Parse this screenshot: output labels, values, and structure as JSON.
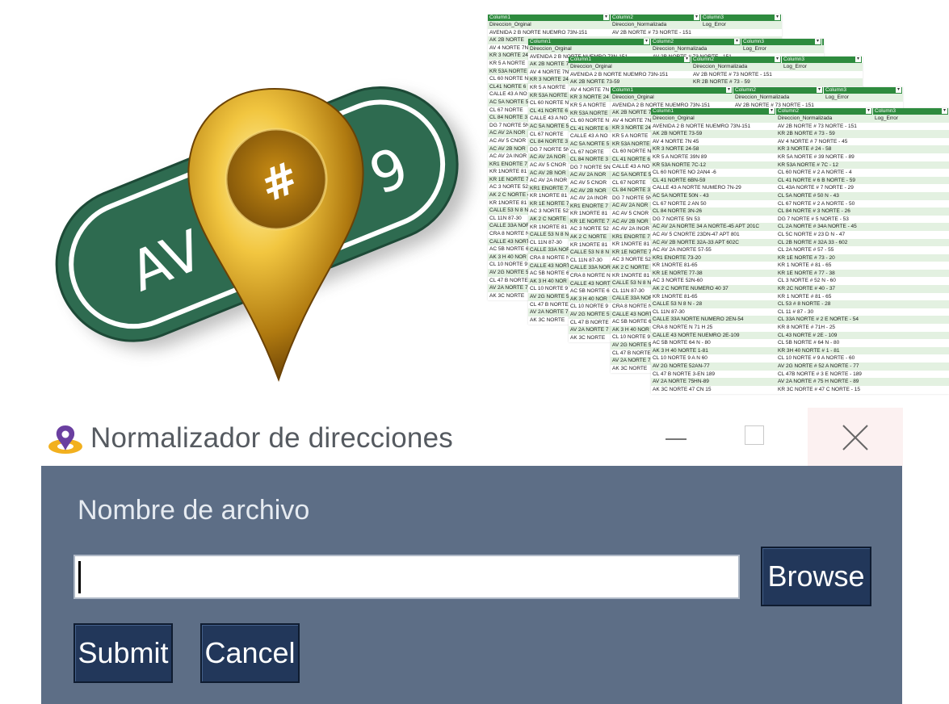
{
  "hero": {
    "sign_text": "AV 5",
    "sign_number": "9",
    "hash_symbol": "#"
  },
  "sheets": [
    {
      "columns": [
        "Column1",
        "Column2",
        "Column3"
      ],
      "rows": [
        [
          "Direccion_Orginal",
          "Direccion_Normalizada",
          "Log_Error"
        ],
        [
          "AVENIDA 2 B NORTE NUEMRO 73N-151",
          "AV 2B NORTE # 73 NORTE - 151",
          ""
        ],
        [
          "AK 2B NORTE",
          "",
          ""
        ],
        [
          "AV 4 NORTE 7N",
          "",
          ""
        ],
        [
          "KR 3 NORTE 24",
          "",
          ""
        ],
        [
          "KR 5 A NORTE",
          "",
          ""
        ],
        [
          "KR 53A NORTE",
          "",
          ""
        ],
        [
          "CL 60 NORTE N",
          "",
          ""
        ],
        [
          "CL41 NORTE 6",
          "",
          ""
        ],
        [
          "CALLE 43 A NO",
          "",
          ""
        ],
        [
          "AC 5A NORTE 5",
          "",
          ""
        ],
        [
          "CL 67 NORTE",
          "",
          ""
        ],
        [
          "CL 84 NORTE 3",
          "",
          ""
        ],
        [
          "DG 7 NORTE 5N",
          "",
          ""
        ],
        [
          "AC AV 2A NOR",
          "",
          ""
        ],
        [
          "AC AV 5 CNOR",
          "",
          ""
        ],
        [
          "AC AV 2B NOR",
          "",
          ""
        ],
        [
          "AC AV 2A INOR",
          "",
          ""
        ],
        [
          "KR1 ENORTE 7",
          "",
          ""
        ],
        [
          "KR 1NORTE 81",
          "",
          ""
        ],
        [
          "KR 1E NORTE 7",
          "",
          ""
        ],
        [
          "AC 3 NORTE 52",
          "",
          ""
        ],
        [
          "AK 2 C NORTE 4",
          "",
          ""
        ],
        [
          "KR 1NORTE 81",
          "",
          ""
        ],
        [
          "CALLE 53 N 8 N",
          "",
          ""
        ],
        [
          "CL 11N 87-30",
          "",
          ""
        ],
        [
          "CALLE 33A NOR",
          "",
          ""
        ],
        [
          "CRA 8 NORTE N",
          "",
          ""
        ],
        [
          "CALLE 43 NORT",
          "",
          ""
        ],
        [
          "AC 5B NORTE 6",
          "",
          ""
        ],
        [
          "AK 3 H 40 NOR",
          "",
          ""
        ],
        [
          "CL 10 NORTE 9",
          "",
          ""
        ],
        [
          "AV 2G NORTE 5",
          "",
          ""
        ],
        [
          "CL 47 B NORTE",
          "",
          ""
        ],
        [
          "AV 2A NORTE 7",
          "",
          ""
        ],
        [
          "AK 3C NORTE",
          "",
          ""
        ]
      ]
    },
    {
      "columns": [
        "Column1",
        "Column2",
        "Column3"
      ],
      "rows": [
        [
          "Direccion_Orginal",
          "Direccion_Normalizada",
          "Log_Error"
        ],
        [
          "AVENIDA 2 B NORTE NUEMRO 73N-151",
          "AV 2B NORTE # 73 NORTE - 151",
          ""
        ],
        [
          "AK 2B NORTE 73",
          "",
          ""
        ],
        [
          "AV 4 NORTE 7N",
          "",
          ""
        ],
        [
          "KR 3 NORTE 24",
          "",
          ""
        ],
        [
          "KR 5 A NORTE",
          "",
          ""
        ],
        [
          "KR 53A NORTE",
          "",
          ""
        ],
        [
          "CL 60 NORTE N",
          "",
          ""
        ],
        [
          "CL 41 NORTE 6",
          "",
          ""
        ],
        [
          "CALLE 43 A NO",
          "",
          ""
        ],
        [
          "AC 5A NORTE 5",
          "",
          ""
        ],
        [
          "CL 67 NORTE",
          "",
          ""
        ],
        [
          "CL 84 NORTE 3",
          "",
          ""
        ],
        [
          "DG 7 NORTE 5N",
          "",
          ""
        ],
        [
          "AC AV 2A NOR",
          "",
          ""
        ],
        [
          "AC AV 5 CNOR",
          "",
          ""
        ],
        [
          "AC AV 2B NOR",
          "",
          ""
        ],
        [
          "AC AV 2A INOR",
          "",
          ""
        ],
        [
          "KR1 ENORTE 7",
          "",
          ""
        ],
        [
          "KR 1NORTE 81",
          "",
          ""
        ],
        [
          "KR 1E NORTE 7",
          "",
          ""
        ],
        [
          "AC 3 NORTE 52",
          "",
          ""
        ],
        [
          "AK 2 C NORTE",
          "",
          ""
        ],
        [
          "KR 1NORTE 81",
          "",
          ""
        ],
        [
          "CALLE 53 N 8 N",
          "",
          ""
        ],
        [
          "CL 11N 87-30",
          "",
          ""
        ],
        [
          "CALLE 33A NOR",
          "",
          ""
        ],
        [
          "CRA 8 NORTE N",
          "",
          ""
        ],
        [
          "CALLE 43 NORT",
          "",
          ""
        ],
        [
          "AC 5B NORTE 6",
          "",
          ""
        ],
        [
          "AK 3 H 40 NOR",
          "",
          ""
        ],
        [
          "CL 10 NORTE 9",
          "",
          ""
        ],
        [
          "AV 2G NORTE 5",
          "",
          ""
        ],
        [
          "CL 47 B NORTE",
          "",
          ""
        ],
        [
          "AV 2A NORTE 7",
          "",
          ""
        ],
        [
          "AK 3C NORTE",
          "",
          ""
        ]
      ]
    },
    {
      "columns": [
        "Column1",
        "Column2",
        "Column3"
      ],
      "rows": [
        [
          "Direccion_Orginal",
          "Direccion_Normalizada",
          "Log_Error"
        ],
        [
          "AVENIDA 2 B NORTE NUEMRO 73N-151",
          "AV 2B NORTE # 73 NORTE - 151",
          ""
        ],
        [
          "AK 2B NORTE 73-59",
          "KR 2B NORTE # 73 - 59",
          ""
        ],
        [
          "AV 4 NORTE 7N",
          "",
          ""
        ],
        [
          "KR 3 NORTE 24",
          "",
          ""
        ],
        [
          "KR 5 A NORTE",
          "",
          ""
        ],
        [
          "KR 53A NORTE",
          "",
          ""
        ],
        [
          "CL 60 NORTE N",
          "",
          ""
        ],
        [
          "CL 41 NORTE 6",
          "",
          ""
        ],
        [
          "CALLE 43 A NO",
          "",
          ""
        ],
        [
          "AC 5A NORTE 5",
          "",
          ""
        ],
        [
          "CL 67 NORTE",
          "",
          ""
        ],
        [
          "CL 84 NORTE 3",
          "",
          ""
        ],
        [
          "DG 7 NORTE 5N",
          "",
          ""
        ],
        [
          "AC AV 2A NOR",
          "",
          ""
        ],
        [
          "AC AV 5 CNOR",
          "",
          ""
        ],
        [
          "AC AV 2B NOR",
          "",
          ""
        ],
        [
          "AC AV 2A INOR",
          "",
          ""
        ],
        [
          "KR1 ENORTE 7",
          "",
          ""
        ],
        [
          "KR 1NORTE 81",
          "",
          ""
        ],
        [
          "KR 1E NORTE 7",
          "",
          ""
        ],
        [
          "AC 3 NORTE 52",
          "",
          ""
        ],
        [
          "AK 2 C NORTE",
          "",
          ""
        ],
        [
          "KR 1NORTE 81",
          "",
          ""
        ],
        [
          "CALLE 53 N 8 N",
          "",
          ""
        ],
        [
          "CL 11N 87-30",
          "",
          ""
        ],
        [
          "CALLE 33A NOR",
          "",
          ""
        ],
        [
          "CRA 8 NORTE N",
          "",
          ""
        ],
        [
          "CALLE 43 NORT",
          "",
          ""
        ],
        [
          "AC 5B NORTE 6",
          "",
          ""
        ],
        [
          "AK 3 H 40 NOR",
          "",
          ""
        ],
        [
          "CL 10 NORTE 9",
          "",
          ""
        ],
        [
          "AV 2G NORTE 5",
          "",
          ""
        ],
        [
          "CL 47 B NORTE",
          "",
          ""
        ],
        [
          "AV 2A NORTE 7",
          "",
          ""
        ],
        [
          "AK 3C NORTE",
          "",
          ""
        ]
      ]
    },
    {
      "columns": [
        "Column1",
        "Column2",
        "Column3"
      ],
      "rows": [
        [
          "Direccion_Orginal",
          "Direccion_Normalizada",
          "Log_Error"
        ],
        [
          "AVENIDA 2 B NORTE NUEMRO 73N-151",
          "AV 2B NORTE # 73 NORTE - 151",
          ""
        ],
        [
          "AK 2B NORTE 73-59",
          "",
          ""
        ],
        [
          "AV 4 NORTE 7N",
          "",
          ""
        ],
        [
          "KR 3 NORTE 24",
          "",
          ""
        ],
        [
          "KR 5 A NORTE",
          "",
          ""
        ],
        [
          "KR 53A NORTE",
          "",
          ""
        ],
        [
          "CL 60 NORTE N",
          "",
          ""
        ],
        [
          "CL 41 NORTE 6",
          "",
          ""
        ],
        [
          "CALLE 43 A NO",
          "",
          ""
        ],
        [
          "AC 5A NORTE 5",
          "",
          ""
        ],
        [
          "CL 67 NORTE",
          "",
          ""
        ],
        [
          "CL 84 NORTE 3",
          "",
          ""
        ],
        [
          "DG 7 NORTE 5N",
          "",
          ""
        ],
        [
          "AC AV 2A NOR",
          "",
          ""
        ],
        [
          "AC AV 5 CNOR",
          "",
          ""
        ],
        [
          "AC AV 2B NOR",
          "",
          ""
        ],
        [
          "AC AV 2A INOR",
          "",
          ""
        ],
        [
          "KR1 ENORTE 7",
          "",
          ""
        ],
        [
          "KR 1NORTE 81",
          "",
          ""
        ],
        [
          "KR 1E NORTE 7",
          "",
          ""
        ],
        [
          "AC 3 NORTE 52",
          "",
          ""
        ],
        [
          "AK 2 C NORTE",
          "",
          ""
        ],
        [
          "KR 1NORTE 81",
          "",
          ""
        ],
        [
          "CALLE 53 N 8 N",
          "",
          ""
        ],
        [
          "CL 11N 87-30",
          "",
          ""
        ],
        [
          "CALLE 33A NOR",
          "",
          ""
        ],
        [
          "CRA 8 NORTE N",
          "",
          ""
        ],
        [
          "CALLE 43 NORT",
          "",
          ""
        ],
        [
          "AC 5B NORTE 6",
          "",
          ""
        ],
        [
          "AK 3 H 40 NOR",
          "",
          ""
        ],
        [
          "CL 10 NORTE 9",
          "",
          ""
        ],
        [
          "AV 2G NORTE 5",
          "",
          ""
        ],
        [
          "CL 47 B NORTE",
          "",
          ""
        ],
        [
          "AV 2A NORTE 7",
          "",
          ""
        ],
        [
          "AK 3C NORTE",
          "",
          ""
        ]
      ]
    },
    {
      "columns": [
        "Column1",
        "Column2",
        "Column3"
      ],
      "rows": [
        [
          "Direccion_Orginal",
          "Direccion_Normalizada",
          "Log_Error"
        ],
        [
          "AVENIDA 2 B NORTE NUEMRO 73N-151",
          "AV 2B NORTE # 73 NORTE - 151",
          ""
        ],
        [
          "AK 2B NORTE 73-59",
          "KR 2B NORTE # 73 - 59",
          ""
        ],
        [
          "AV 4 NORTE 7N 45",
          "AV 4 NORTE # 7 NORTE - 45",
          ""
        ],
        [
          "KR 3 NORTE 24-58",
          "KR 3 NORTE # 24 - 58",
          ""
        ],
        [
          "KR 5 A NORTE 39N 89",
          "KR 5A NORTE # 39 NORTE - 89",
          ""
        ],
        [
          "KR 53A NORTE  7C-12",
          "KR 53A NORTE # 7C - 12",
          ""
        ],
        [
          "CL 60 NORTE NO  2AN4 -6",
          "CL 60 NORTE # 2 A NORTE - 4",
          ""
        ],
        [
          "CL 41 NORTE 6BN-59",
          "CL 41 NORTE # 6 B NORTE - 59",
          ""
        ],
        [
          "CALLE 43 A NORTE NUMERO 7N-29",
          "CL 43A NORTE # 7 NORTE - 29",
          ""
        ],
        [
          "AC 5A NORTE 50N - 43",
          "CL 5A NORTE # 50 N - 43",
          ""
        ],
        [
          "CL 67 NORTE  2 AN 50",
          "CL 67 NORTE # 2 A NORTE - 50",
          ""
        ],
        [
          "CL 84 NORTE 3N-26",
          "CL 84 NORTE # 3 NORTE - 26",
          ""
        ],
        [
          "DG 7 NORTE 5N 53",
          "DG 7 NORTE # 5 NORTE - 53",
          ""
        ],
        [
          "AC AV 2A NORTE 34 A NORTE-45 APT 201C",
          "CL 2A NORTE # 34A NORTE - 45",
          ""
        ],
        [
          "AC  AV 5 CNORTE 23DN-47 APT 801",
          "CL 5C NORTE # 23 D N - 47",
          ""
        ],
        [
          "AC AV 2B NORTE 32A-33 APT 602C",
          "CL 2B NORTE # 32A 33 - 602",
          ""
        ],
        [
          "AC AV 2A INORTE 57-55",
          "CL 2A NORTE # 57 - 55",
          ""
        ],
        [
          "KR1 ENORTE 73-20",
          "KR 1E NORTE # 73 - 20",
          ""
        ],
        [
          "KR 1NORTE 81-65",
          "KR 1 NORTE # 81 - 65",
          ""
        ],
        [
          "KR 1E NORTE 77-38",
          "KR 1E NORTE # 77 - 38",
          ""
        ],
        [
          "AC 3 NORTE 52N-60",
          "CL 3 NORTE # 52 N - 60",
          ""
        ],
        [
          "AK 2 C NORTE NUMERO 40 37",
          "KR 2C NORTE # 40 - 37",
          ""
        ],
        [
          "KR 1NORTE 81-65",
          "KR 1 NORTE # 81 - 65",
          ""
        ],
        [
          "CALLE 53 N 8 N - 28",
          "CL 53 # 8 NORTE - 28",
          ""
        ],
        [
          "CL 11N 87-30",
          "CL 11 # 87 - 30",
          ""
        ],
        [
          "CALLE 33A NORTE NUMERO 2EN-54",
          "CL 33A NORTE # 2 E NORTE - 54",
          ""
        ],
        [
          "CRA 8 NORTE N 71 H 25",
          "KR 8 NORTE # 71H - 25",
          ""
        ],
        [
          "CALLE 43 NORTE NUEMRO 2E-109",
          "CL 43 NORTE # 2E - 109",
          ""
        ],
        [
          "AC 5B NORTE 64 N - 80",
          "CL 5B NORTE # 64 N - 80",
          ""
        ],
        [
          "AK 3 H 40 NORTE 1-81",
          "KR 3H 40 NORTE # 1 - 81",
          ""
        ],
        [
          "CL 10 NORTE 9 A N  60",
          "CL 10 NORTE # 9 A NORTE - 60",
          ""
        ],
        [
          "AV 2G NORTE 52AN-77",
          "AV 2G NORTE # 52 A NORTE - 77",
          ""
        ],
        [
          "CL 47 B NORTE 3-EN 189",
          "CL 47B NORTE # 3 E NORTE - 189",
          ""
        ],
        [
          "AV 2A NORTE 75HN-89",
          "AV 2A NORTE # 75 H NORTE - 89",
          ""
        ],
        [
          "AK 3C NORTE 47 CN 15",
          "KR 3C NORTE # 47 C NORTE - 15",
          ""
        ]
      ]
    }
  ],
  "window": {
    "title": "Normalizador de direcciones",
    "file_label": "Nombre de archivo",
    "file_value": "",
    "browse_label": "Browse",
    "submit_label": "Submit",
    "cancel_label": "Cancel"
  },
  "colors": {
    "sign_green": "#2e6b50",
    "pin_gold": "#d9a520",
    "sheet_header": "#2e8b3e",
    "sheet_band": "#e3f1e1",
    "window_client": "#5d6e86",
    "button_navy": "#22375a",
    "icon_purple": "#6a3fa0",
    "icon_gold": "#f2b01e"
  }
}
